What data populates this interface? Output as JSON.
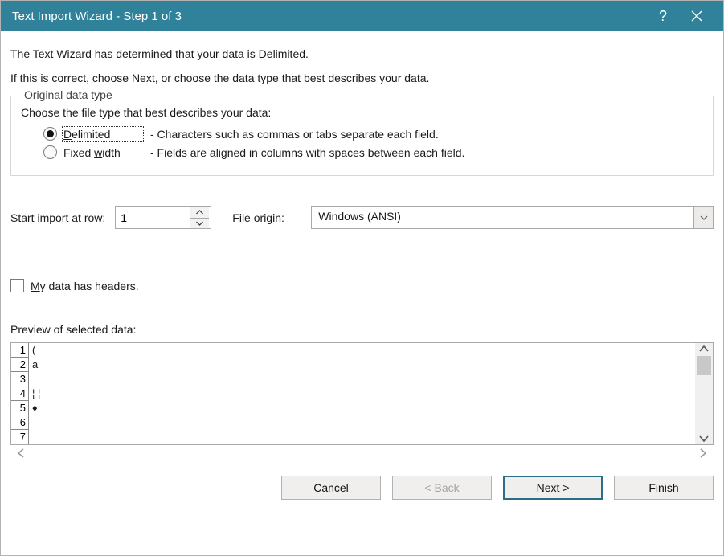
{
  "title": "Text Import Wizard - Step 1 of 3",
  "intro1": "The Text Wizard has determined that your data is Delimited.",
  "intro2": "If this is correct, choose Next, or choose the data type that best describes your data.",
  "fieldset": {
    "legend": "Original data type",
    "desc": "Choose the file type that best describes your data:",
    "options": [
      {
        "label_accel": "D",
        "label_rest": "elimited",
        "explain": "- Characters such as commas or tabs separate each field.",
        "checked": true
      },
      {
        "label_pre": "Fixed ",
        "label_accel": "w",
        "label_rest": "idth",
        "explain": "- Fields are aligned in columns with spaces between each field.",
        "checked": false
      }
    ]
  },
  "start_row": {
    "label_pre": "Start import at ",
    "label_accel": "r",
    "label_rest": "ow:",
    "value": "1"
  },
  "file_origin": {
    "label_pre": "File ",
    "label_accel": "o",
    "label_rest": "rigin:",
    "value": "Windows (ANSI)"
  },
  "headers_chk": {
    "label_accel": "M",
    "label_rest": "y data has headers.",
    "checked": false
  },
  "preview": {
    "label": "Preview of selected data:",
    "rows": [
      {
        "n": "1",
        "v": "("
      },
      {
        "n": "2",
        "v": "a"
      },
      {
        "n": "3",
        "v": ""
      },
      {
        "n": "4",
        "v": "¦ ¦"
      },
      {
        "n": "5",
        "v": "♦"
      },
      {
        "n": "6",
        "v": ""
      },
      {
        "n": "7",
        "v": ""
      }
    ]
  },
  "buttons": {
    "cancel": "Cancel",
    "back_lt": "< ",
    "back_accel": "B",
    "back_rest": "ack",
    "next_accel": "N",
    "next_rest": "ext >",
    "finish_accel": "F",
    "finish_rest": "inish"
  },
  "icons": {
    "help": "?",
    "close": "close"
  }
}
